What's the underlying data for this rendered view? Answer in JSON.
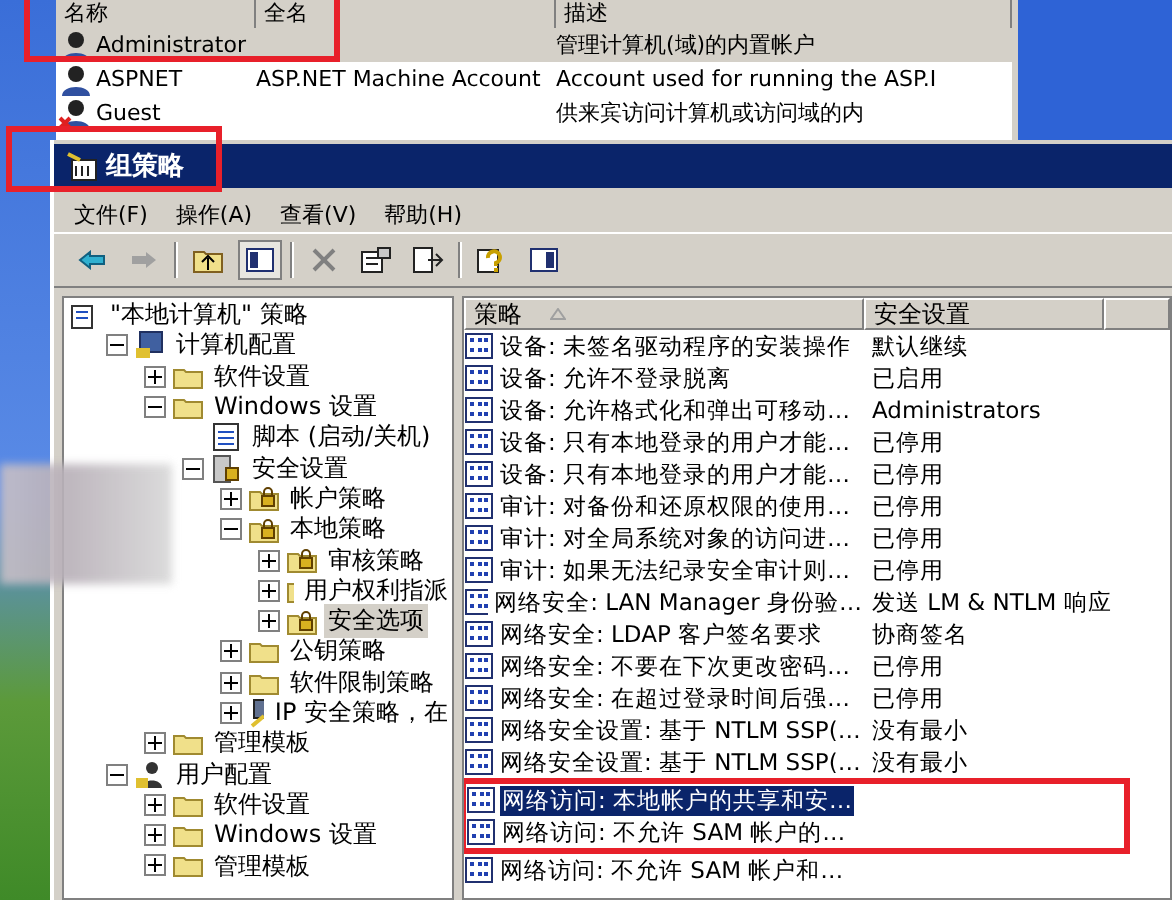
{
  "user_list": {
    "columns": [
      "名称",
      "全名",
      "描述"
    ],
    "rows": [
      {
        "name": "Administrator",
        "full_name": "",
        "description": "管理计算机(域)的内置帐户",
        "selected": true,
        "disabled": false
      },
      {
        "name": "ASPNET",
        "full_name": "ASP.NET Machine Account",
        "description": "Account used for running the ASP.I",
        "selected": false,
        "disabled": false
      },
      {
        "name": "Guest",
        "full_name": "",
        "description": "供来宾访问计算机或访问域的内",
        "selected": false,
        "disabled": true
      }
    ]
  },
  "window": {
    "title": "组策略"
  },
  "menu": [
    "文件(F)",
    "操作(A)",
    "查看(V)",
    "帮助(H)"
  ],
  "tree": [
    {
      "label": "\"本地计算机\" 策略",
      "kind": "policy",
      "selected": false,
      "children": [
        {
          "label": "计算机配置",
          "kind": "computer",
          "expanded": true,
          "selected": false,
          "children": [
            {
              "label": "软件设置",
              "kind": "folder",
              "expanded": false,
              "selected": false
            },
            {
              "label": "Windows 设置",
              "kind": "folder",
              "expanded": true,
              "selected": false,
              "children": [
                {
                  "label": "脚本 (启动/关机)",
                  "kind": "script",
                  "selected": false
                },
                {
                  "label": "安全设置",
                  "kind": "security",
                  "expanded": true,
                  "selected": false,
                  "children": [
                    {
                      "label": "帐户策略",
                      "kind": "lockfolder",
                      "expanded": false,
                      "selected": false
                    },
                    {
                      "label": "本地策略",
                      "kind": "lockfolder",
                      "expanded": true,
                      "selected": false,
                      "children": [
                        {
                          "label": "审核策略",
                          "kind": "lockfolder",
                          "expanded": false,
                          "selected": false
                        },
                        {
                          "label": "用户权利指派",
                          "kind": "lockfolder",
                          "expanded": false,
                          "selected": false
                        },
                        {
                          "label": "安全选项",
                          "kind": "lockfolder",
                          "expanded": false,
                          "selected": true
                        }
                      ]
                    },
                    {
                      "label": "公钥策略",
                      "kind": "folder",
                      "expanded": false,
                      "selected": false
                    },
                    {
                      "label": "软件限制策略",
                      "kind": "folder",
                      "expanded": false,
                      "selected": false
                    },
                    {
                      "label": "IP 安全策略，在",
                      "kind": "ip",
                      "expanded": false,
                      "selected": false
                    }
                  ]
                }
              ]
            },
            {
              "label": "管理模板",
              "kind": "folder",
              "expanded": false,
              "selected": false
            }
          ]
        },
        {
          "label": "用户配置",
          "kind": "user",
          "expanded": true,
          "selected": false,
          "children": [
            {
              "label": "软件设置",
              "kind": "folder",
              "expanded": false,
              "selected": false
            },
            {
              "label": "Windows 设置",
              "kind": "folder",
              "expanded": false,
              "selected": false
            },
            {
              "label": "管理模板",
              "kind": "folder",
              "expanded": false,
              "selected": false
            }
          ]
        }
      ]
    }
  ],
  "policy_list": {
    "columns": [
      "策略",
      "安全设置"
    ],
    "rows": [
      {
        "policy": "设备: 未签名驱动程序的安装操作",
        "setting": "默认继续",
        "selected": false,
        "annotated": false
      },
      {
        "policy": "设备: 允许不登录脱离",
        "setting": "已启用",
        "selected": false,
        "annotated": false
      },
      {
        "policy": "设备: 允许格式化和弹出可移动…",
        "setting": "Administrators",
        "selected": false,
        "annotated": false
      },
      {
        "policy": "设备: 只有本地登录的用户才能…",
        "setting": "已停用",
        "selected": false,
        "annotated": false
      },
      {
        "policy": "设备: 只有本地登录的用户才能…",
        "setting": "已停用",
        "selected": false,
        "annotated": false
      },
      {
        "policy": "审计: 对备份和还原权限的使用…",
        "setting": "已停用",
        "selected": false,
        "annotated": false
      },
      {
        "policy": "审计: 对全局系统对象的访问进…",
        "setting": "已停用",
        "selected": false,
        "annotated": false
      },
      {
        "policy": "审计: 如果无法纪录安全审计则…",
        "setting": "已停用",
        "selected": false,
        "annotated": false
      },
      {
        "policy": "网络安全: LAN Manager 身份验…",
        "setting": "发送 LM & NTLM 响应",
        "selected": false,
        "annotated": false
      },
      {
        "policy": "网络安全: LDAP 客户签名要求",
        "setting": "协商签名",
        "selected": false,
        "annotated": false
      },
      {
        "policy": "网络安全: 不要在下次更改密码…",
        "setting": "已停用",
        "selected": false,
        "annotated": false
      },
      {
        "policy": "网络安全: 在超过登录时间后强…",
        "setting": "已停用",
        "selected": false,
        "annotated": false
      },
      {
        "policy": "网络安全设置: 基于 NTLM SSP(…",
        "setting": "没有最小",
        "selected": false,
        "annotated": false
      },
      {
        "policy": "网络安全设置: 基于 NTLM SSP(…",
        "setting": "没有最小",
        "selected": false,
        "annotated": false
      },
      {
        "policy": "网络访问: 本地帐户的共享和安…",
        "setting": "",
        "selected": true,
        "annotated": true
      },
      {
        "policy": "网络访问: 不允许 SAM 帐户的…",
        "setting": "",
        "selected": false,
        "annotated": true
      },
      {
        "policy": "网络访问: 不允许 SAM 帐户和…",
        "setting": "",
        "selected": false,
        "annotated": false
      }
    ]
  }
}
